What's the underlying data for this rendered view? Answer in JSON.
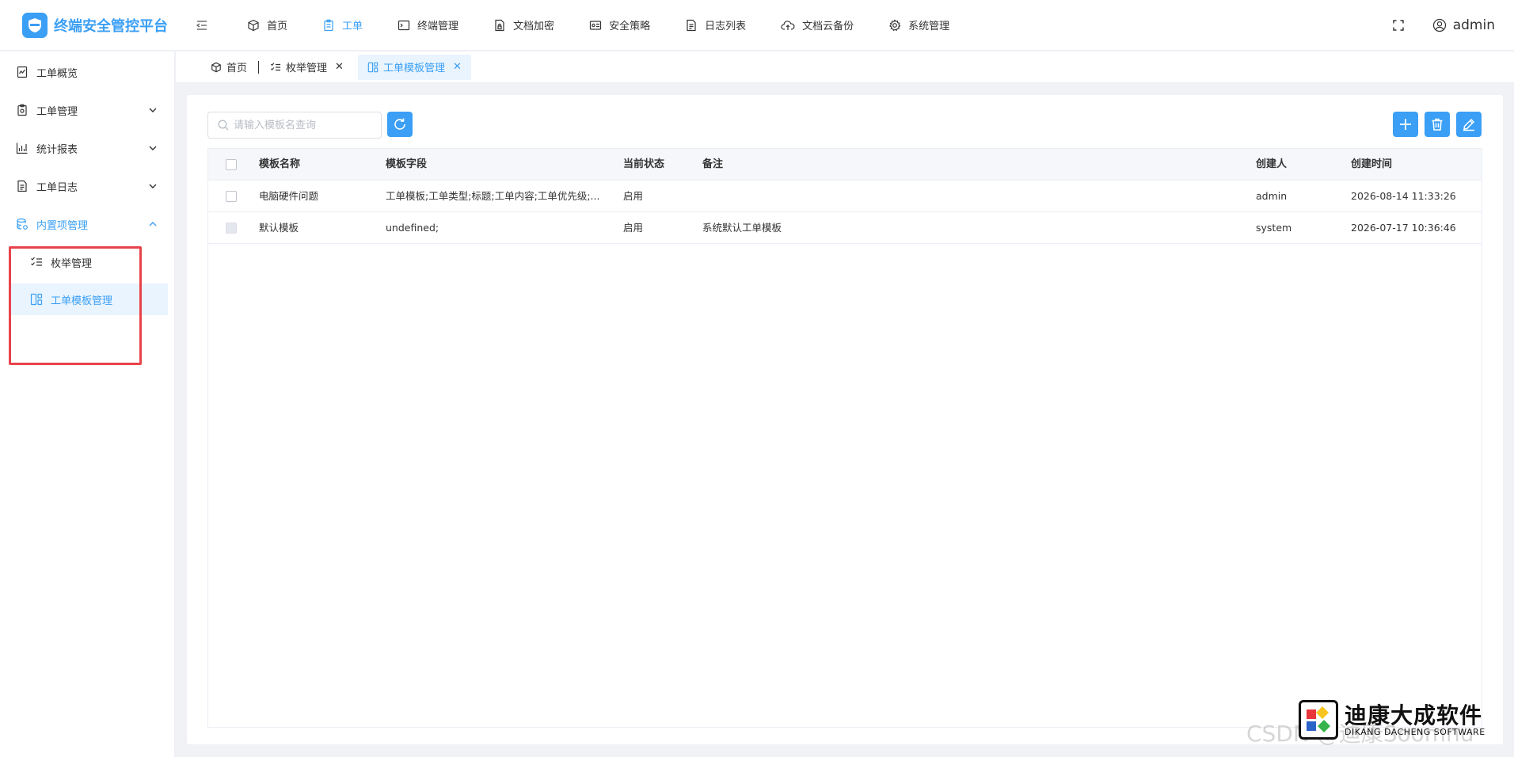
{
  "brand": {
    "title": "终端安全管控平台"
  },
  "topnav": [
    {
      "label": "首页",
      "icon": "cube-icon"
    },
    {
      "label": "工单",
      "icon": "clipboard-icon",
      "active": true
    },
    {
      "label": "终端管理",
      "icon": "terminal-icon"
    },
    {
      "label": "文档加密",
      "icon": "doc-lock-icon"
    },
    {
      "label": "安全策略",
      "icon": "id-card-icon"
    },
    {
      "label": "日志列表",
      "icon": "document-icon"
    },
    {
      "label": "文档云备份",
      "icon": "cloud-upload-icon"
    },
    {
      "label": "系统管理",
      "icon": "gear-icon"
    }
  ],
  "user": {
    "name": "admin"
  },
  "sidebar": {
    "items": [
      {
        "label": "工单概览",
        "icon": "chart-doc-icon"
      },
      {
        "label": "工单管理",
        "icon": "clipboard-icon"
      },
      {
        "label": "统计报表",
        "icon": "bar-chart-icon"
      },
      {
        "label": "工单日志",
        "icon": "document-icon"
      },
      {
        "label": "内置项管理",
        "icon": "database-icon"
      }
    ],
    "subitems": [
      {
        "label": "枚举管理",
        "icon": "checklist-icon"
      },
      {
        "label": "工单模板管理",
        "icon": "template-icon",
        "active": true
      }
    ]
  },
  "tabs": [
    {
      "label": "首页"
    },
    {
      "label": "枚举管理"
    },
    {
      "label": "工单模板管理",
      "active": true
    }
  ],
  "toolbar": {
    "search_placeholder": "请输入模板名查询"
  },
  "table": {
    "headers": {
      "name": "模板名称",
      "field": "模板字段",
      "status": "当前状态",
      "note": "备注",
      "creator": "创建人",
      "time": "创建时间"
    },
    "rows": [
      {
        "name": "电脑硬件问题",
        "field": "工单模板;工单类型;标题;工单内容;工单优先级;...",
        "status": "启用",
        "note": "",
        "creator": "admin",
        "time": "2026-08-14 11:33:26",
        "checkbox_disabled": false
      },
      {
        "name": "默认模板",
        "field": "undefined;",
        "status": "启用",
        "note": "系统默认工单模板",
        "creator": "system",
        "time": "2026-07-17 10:36:46",
        "checkbox_disabled": true
      }
    ]
  },
  "watermark": {
    "title": "迪康大成软件",
    "subtitle": "DIKANG DACHENG SOFTWARE",
    "csdn": "CSDN @迪康Soomnu"
  },
  "colors": {
    "accent": "#3a9ff5",
    "highlight": "#e8434b",
    "active_bg": "#e9f4fe"
  }
}
